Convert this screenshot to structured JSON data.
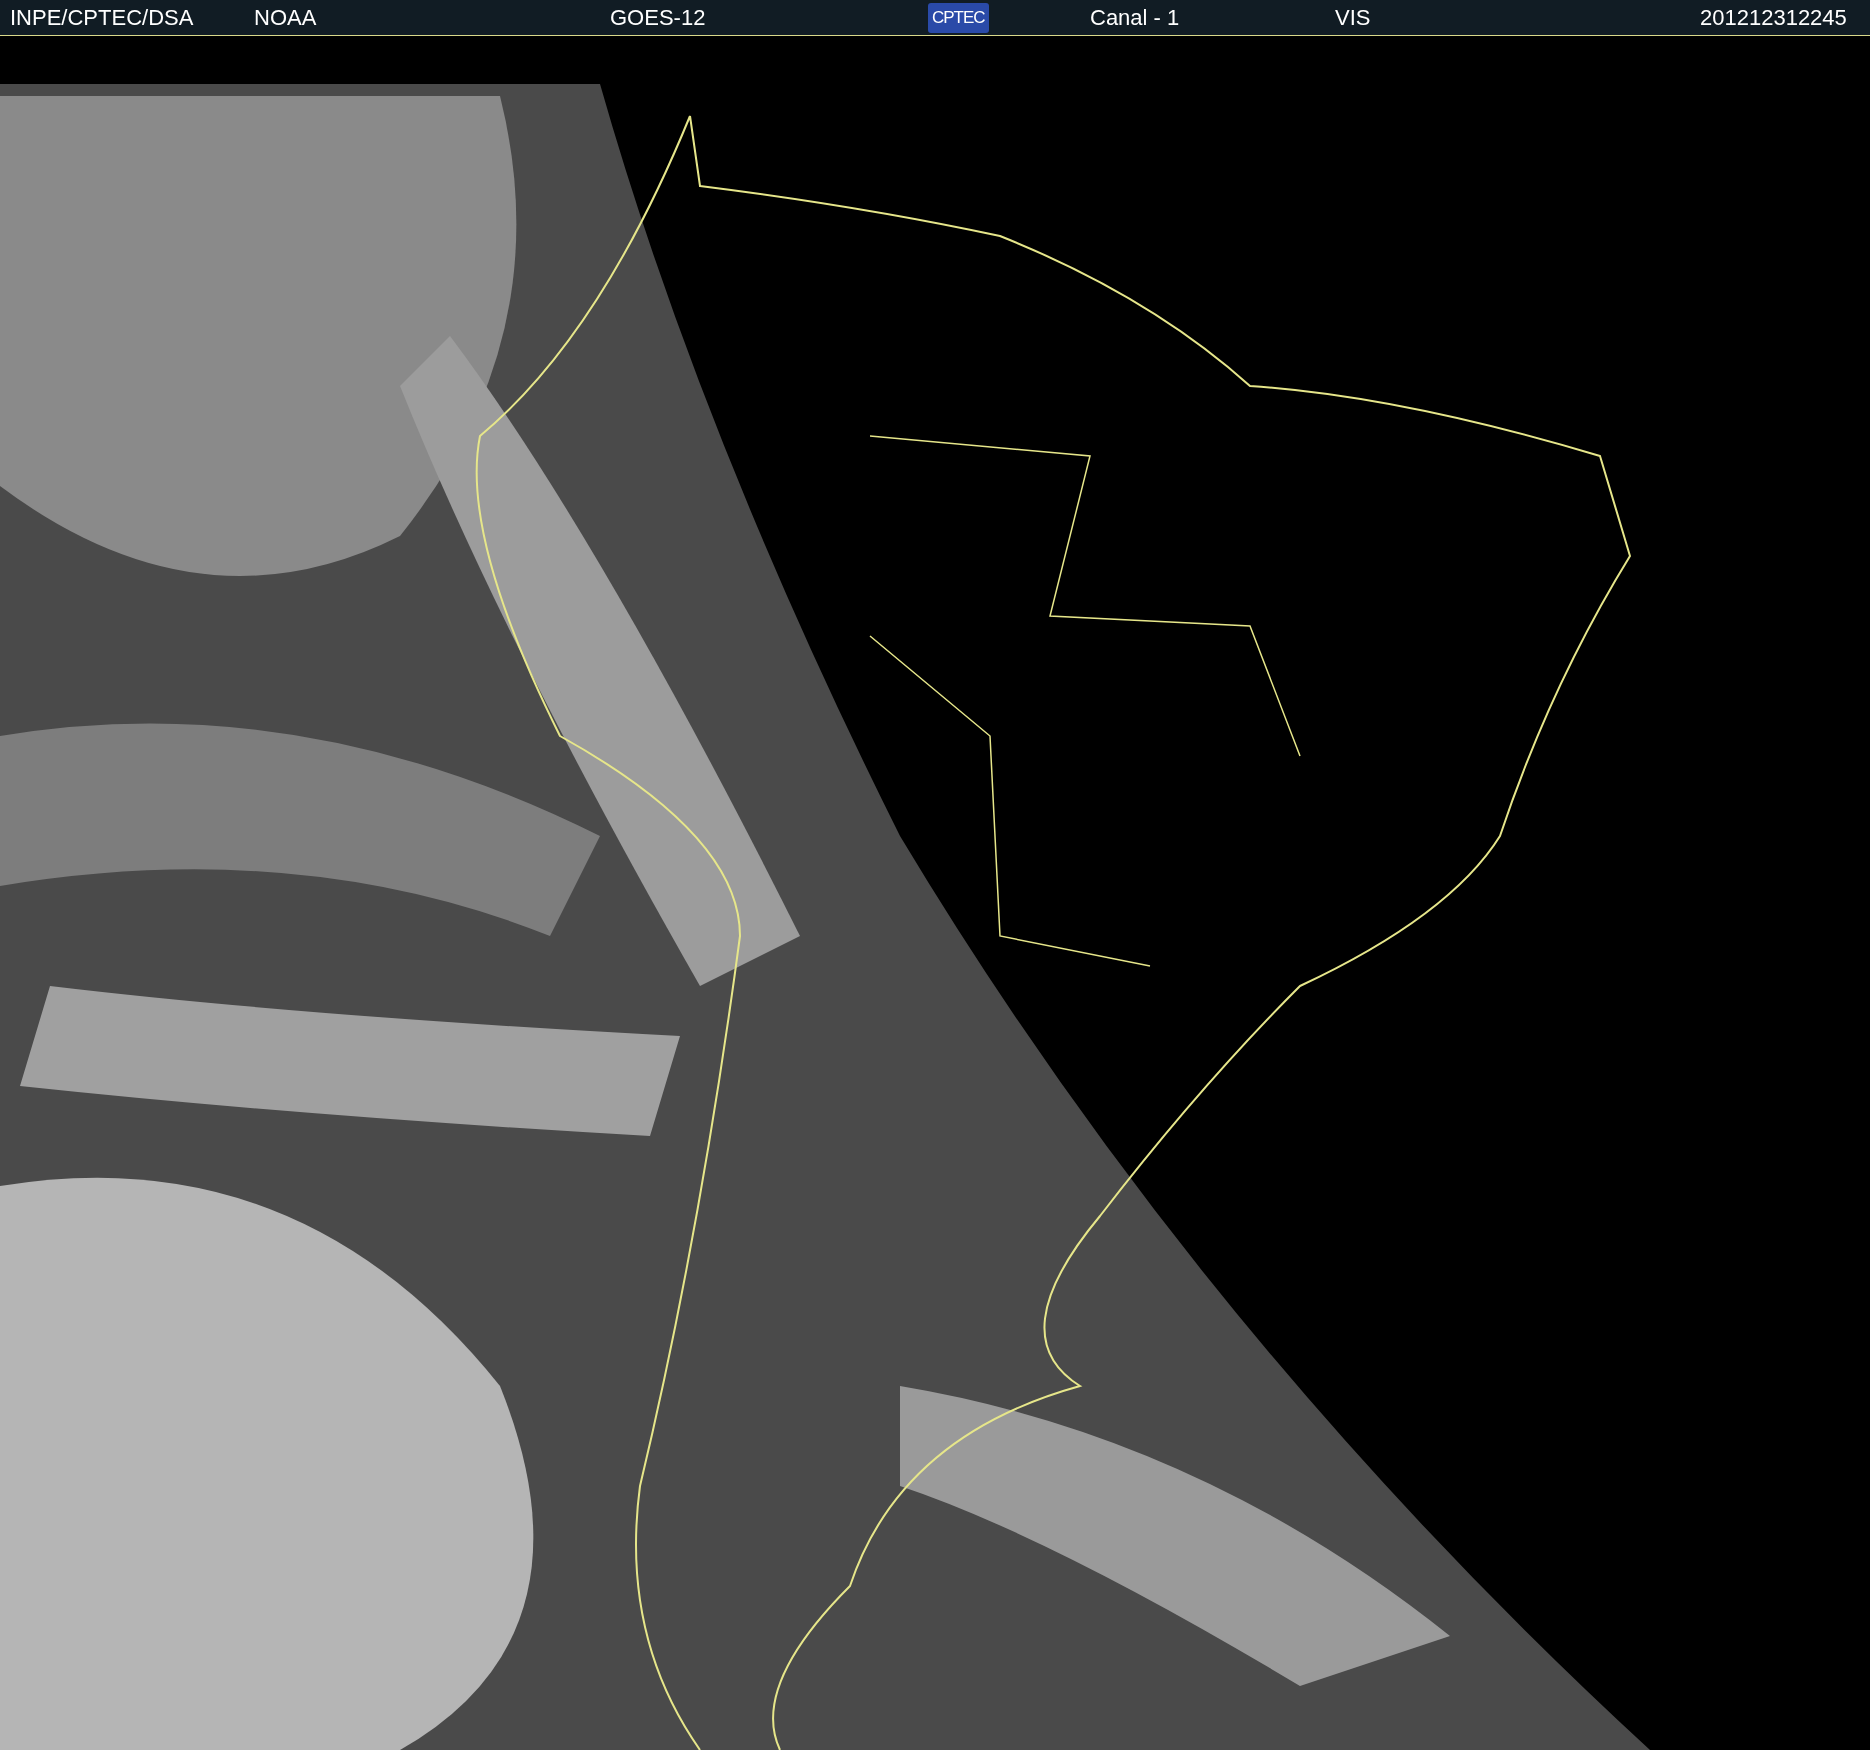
{
  "header": {
    "items": [
      {
        "text": "INPE/CPTEC/DSA"
      },
      {
        "text": "NOAA"
      },
      {
        "text": "GOES-12"
      },
      {
        "text": "CPTEC",
        "kind": "logo"
      },
      {
        "text": "Canal - 1"
      },
      {
        "text": "VIS"
      },
      {
        "text": "201212312245"
      }
    ]
  }
}
